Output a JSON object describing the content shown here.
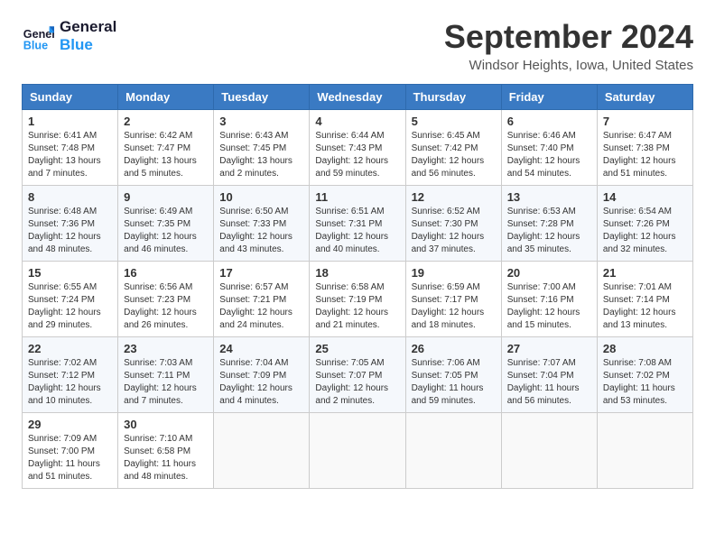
{
  "header": {
    "logo_line1": "General",
    "logo_line2": "Blue",
    "month_title": "September 2024",
    "location": "Windsor Heights, Iowa, United States"
  },
  "days_of_week": [
    "Sunday",
    "Monday",
    "Tuesday",
    "Wednesday",
    "Thursday",
    "Friday",
    "Saturday"
  ],
  "weeks": [
    [
      {
        "day": 1,
        "sunrise": "6:41 AM",
        "sunset": "7:48 PM",
        "daylight": "13 hours and 7 minutes"
      },
      {
        "day": 2,
        "sunrise": "6:42 AM",
        "sunset": "7:47 PM",
        "daylight": "13 hours and 5 minutes"
      },
      {
        "day": 3,
        "sunrise": "6:43 AM",
        "sunset": "7:45 PM",
        "daylight": "13 hours and 2 minutes"
      },
      {
        "day": 4,
        "sunrise": "6:44 AM",
        "sunset": "7:43 PM",
        "daylight": "12 hours and 59 minutes"
      },
      {
        "day": 5,
        "sunrise": "6:45 AM",
        "sunset": "7:42 PM",
        "daylight": "12 hours and 56 minutes"
      },
      {
        "day": 6,
        "sunrise": "6:46 AM",
        "sunset": "7:40 PM",
        "daylight": "12 hours and 54 minutes"
      },
      {
        "day": 7,
        "sunrise": "6:47 AM",
        "sunset": "7:38 PM",
        "daylight": "12 hours and 51 minutes"
      }
    ],
    [
      {
        "day": 8,
        "sunrise": "6:48 AM",
        "sunset": "7:36 PM",
        "daylight": "12 hours and 48 minutes"
      },
      {
        "day": 9,
        "sunrise": "6:49 AM",
        "sunset": "7:35 PM",
        "daylight": "12 hours and 46 minutes"
      },
      {
        "day": 10,
        "sunrise": "6:50 AM",
        "sunset": "7:33 PM",
        "daylight": "12 hours and 43 minutes"
      },
      {
        "day": 11,
        "sunrise": "6:51 AM",
        "sunset": "7:31 PM",
        "daylight": "12 hours and 40 minutes"
      },
      {
        "day": 12,
        "sunrise": "6:52 AM",
        "sunset": "7:30 PM",
        "daylight": "12 hours and 37 minutes"
      },
      {
        "day": 13,
        "sunrise": "6:53 AM",
        "sunset": "7:28 PM",
        "daylight": "12 hours and 35 minutes"
      },
      {
        "day": 14,
        "sunrise": "6:54 AM",
        "sunset": "7:26 PM",
        "daylight": "12 hours and 32 minutes"
      }
    ],
    [
      {
        "day": 15,
        "sunrise": "6:55 AM",
        "sunset": "7:24 PM",
        "daylight": "12 hours and 29 minutes"
      },
      {
        "day": 16,
        "sunrise": "6:56 AM",
        "sunset": "7:23 PM",
        "daylight": "12 hours and 26 minutes"
      },
      {
        "day": 17,
        "sunrise": "6:57 AM",
        "sunset": "7:21 PM",
        "daylight": "12 hours and 24 minutes"
      },
      {
        "day": 18,
        "sunrise": "6:58 AM",
        "sunset": "7:19 PM",
        "daylight": "12 hours and 21 minutes"
      },
      {
        "day": 19,
        "sunrise": "6:59 AM",
        "sunset": "7:17 PM",
        "daylight": "12 hours and 18 minutes"
      },
      {
        "day": 20,
        "sunrise": "7:00 AM",
        "sunset": "7:16 PM",
        "daylight": "12 hours and 15 minutes"
      },
      {
        "day": 21,
        "sunrise": "7:01 AM",
        "sunset": "7:14 PM",
        "daylight": "12 hours and 13 minutes"
      }
    ],
    [
      {
        "day": 22,
        "sunrise": "7:02 AM",
        "sunset": "7:12 PM",
        "daylight": "12 hours and 10 minutes"
      },
      {
        "day": 23,
        "sunrise": "7:03 AM",
        "sunset": "7:11 PM",
        "daylight": "12 hours and 7 minutes"
      },
      {
        "day": 24,
        "sunrise": "7:04 AM",
        "sunset": "7:09 PM",
        "daylight": "12 hours and 4 minutes"
      },
      {
        "day": 25,
        "sunrise": "7:05 AM",
        "sunset": "7:07 PM",
        "daylight": "12 hours and 2 minutes"
      },
      {
        "day": 26,
        "sunrise": "7:06 AM",
        "sunset": "7:05 PM",
        "daylight": "11 hours and 59 minutes"
      },
      {
        "day": 27,
        "sunrise": "7:07 AM",
        "sunset": "7:04 PM",
        "daylight": "11 hours and 56 minutes"
      },
      {
        "day": 28,
        "sunrise": "7:08 AM",
        "sunset": "7:02 PM",
        "daylight": "11 hours and 53 minutes"
      }
    ],
    [
      {
        "day": 29,
        "sunrise": "7:09 AM",
        "sunset": "7:00 PM",
        "daylight": "11 hours and 51 minutes"
      },
      {
        "day": 30,
        "sunrise": "7:10 AM",
        "sunset": "6:58 PM",
        "daylight": "11 hours and 48 minutes"
      },
      null,
      null,
      null,
      null,
      null
    ]
  ]
}
